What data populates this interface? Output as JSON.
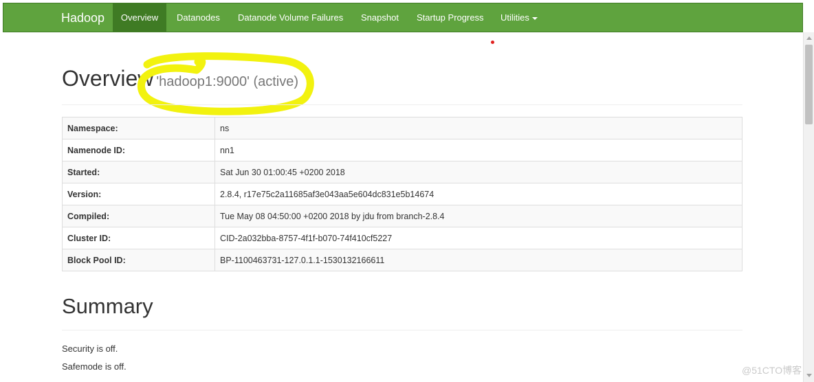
{
  "navbar": {
    "brand": "Hadoop",
    "items": [
      {
        "label": "Overview",
        "active": true
      },
      {
        "label": "Datanodes"
      },
      {
        "label": "Datanode Volume Failures"
      },
      {
        "label": "Snapshot"
      },
      {
        "label": "Startup Progress"
      },
      {
        "label": "Utilities",
        "dropdown": true
      }
    ]
  },
  "overview": {
    "title": "Overview",
    "subtitle": "'hadoop1:9000' (active)",
    "rows": [
      {
        "key": "Namespace:",
        "value": "ns"
      },
      {
        "key": "Namenode ID:",
        "value": "nn1"
      },
      {
        "key": "Started:",
        "value": "Sat Jun 30 01:00:45 +0200 2018"
      },
      {
        "key": "Version:",
        "value": "2.8.4, r17e75c2a11685af3e043aa5e604dc831e5b14674"
      },
      {
        "key": "Compiled:",
        "value": "Tue May 08 04:50:00 +0200 2018 by jdu from branch-2.8.4"
      },
      {
        "key": "Cluster ID:",
        "value": "CID-2a032bba-8757-4f1f-b070-74f410cf5227"
      },
      {
        "key": "Block Pool ID:",
        "value": "BP-1100463731-127.0.1.1-1530132166611"
      }
    ]
  },
  "summary": {
    "title": "Summary",
    "lines": [
      "Security is off.",
      "Safemode is off."
    ]
  },
  "watermark": "@51CTO博客",
  "colors": {
    "navbar": "#5fa33e",
    "navbar_active": "#3f7b24",
    "highlight": "#f2f20f",
    "dot": "#e0211f"
  }
}
